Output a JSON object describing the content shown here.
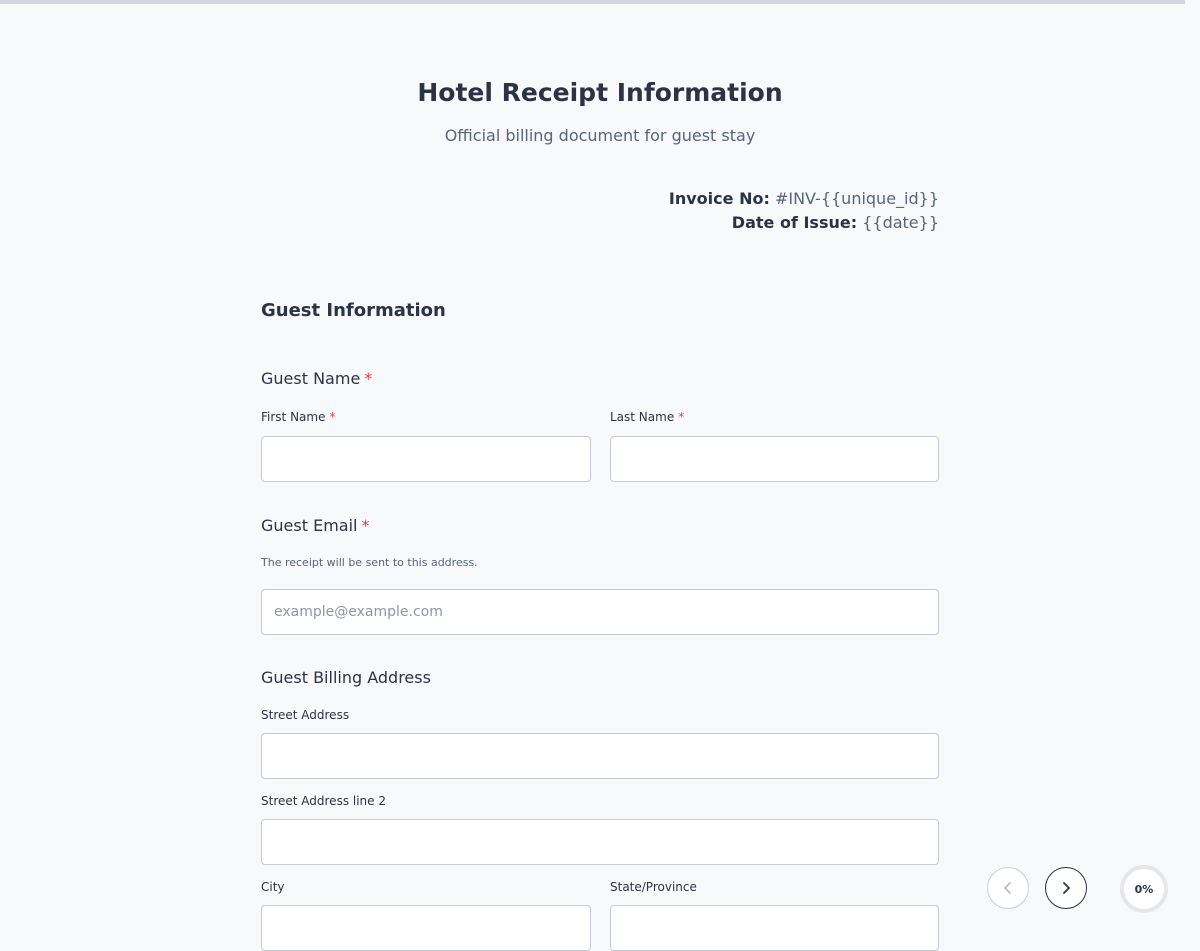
{
  "form": {
    "title": "Hotel Receipt Information",
    "subtitle": "Official billing document for guest stay",
    "invoice": {
      "number_label": "Invoice No:",
      "number_value": "#INV-{{unique_id}}",
      "date_label": "Date of Issue:",
      "date_value": "{{date}}"
    },
    "section_title": "Guest Information",
    "guest_name": {
      "label": "Guest Name",
      "required_mark": "*",
      "first_label": "First Name",
      "last_label": "Last Name",
      "first_value": "",
      "last_value": ""
    },
    "guest_email": {
      "label": "Guest Email",
      "required_mark": "*",
      "hint": "The receipt will be sent to this address.",
      "placeholder": "example@example.com",
      "value": ""
    },
    "billing_address": {
      "label": "Guest Billing Address",
      "street_label": "Street Address",
      "street2_label": "Street Address line 2",
      "city_label": "City",
      "state_label": "State/Province"
    }
  },
  "navigation": {
    "prev_icon": "chevron-left-icon",
    "next_icon": "chevron-right-icon",
    "progress_text": "0%",
    "progress": 0
  },
  "colors": {
    "required": "#f23a3c",
    "text": "#2c3345",
    "muted": "#57647e",
    "border": "#c3cad8",
    "background": "#f8f9fa"
  }
}
